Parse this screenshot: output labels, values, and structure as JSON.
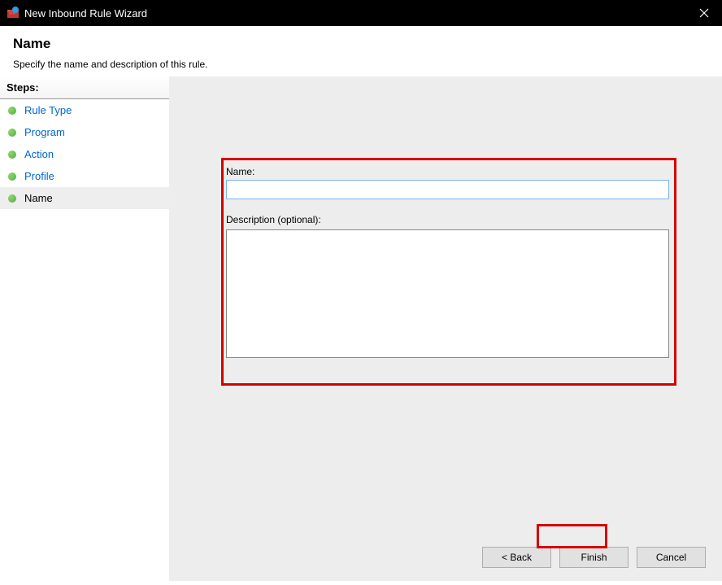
{
  "titlebar": {
    "title": "New Inbound Rule Wizard"
  },
  "header": {
    "title": "Name",
    "description": "Specify the name and description of this rule."
  },
  "sidebar": {
    "steps_label": "Steps:",
    "items": [
      {
        "label": "Rule Type",
        "active": false
      },
      {
        "label": "Program",
        "active": false
      },
      {
        "label": "Action",
        "active": false
      },
      {
        "label": "Profile",
        "active": false
      },
      {
        "label": "Name",
        "active": true
      }
    ]
  },
  "form": {
    "name_label": "Name:",
    "name_value": "",
    "desc_label": "Description (optional):",
    "desc_value": ""
  },
  "buttons": {
    "back": "< Back",
    "finish": "Finish",
    "cancel": "Cancel"
  }
}
